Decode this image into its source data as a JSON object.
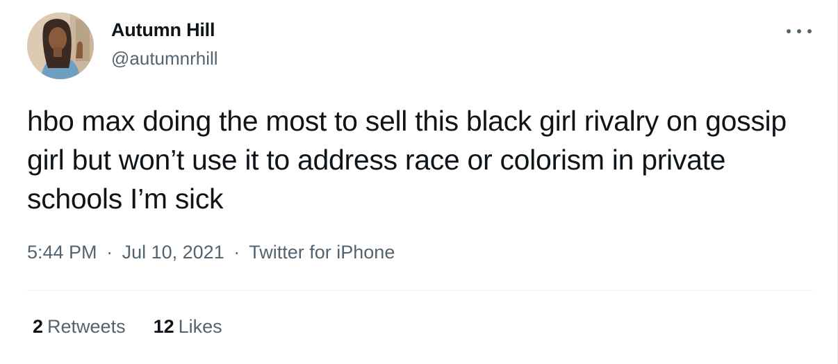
{
  "author": {
    "display_name": "Autumn Hill",
    "handle": "@autumnrhill",
    "avatar_icon": "user-avatar-photo"
  },
  "more_icon": "more-options-icon",
  "tweet": {
    "text": "hbo max doing the most to sell this black girl rivalry on gossip girl but won’t use it to address race or colorism in private schools I’m sick",
    "time": "5:44 PM",
    "separator": "·",
    "date": "Jul 10, 2021",
    "source": "Twitter for iPhone"
  },
  "stats": {
    "retweets_count": "2",
    "retweets_label": "Retweets",
    "likes_count": "12",
    "likes_label": "Likes"
  },
  "colors": {
    "text_primary": "#0f1419",
    "text_secondary": "#536471",
    "divider": "#eff3f4"
  }
}
